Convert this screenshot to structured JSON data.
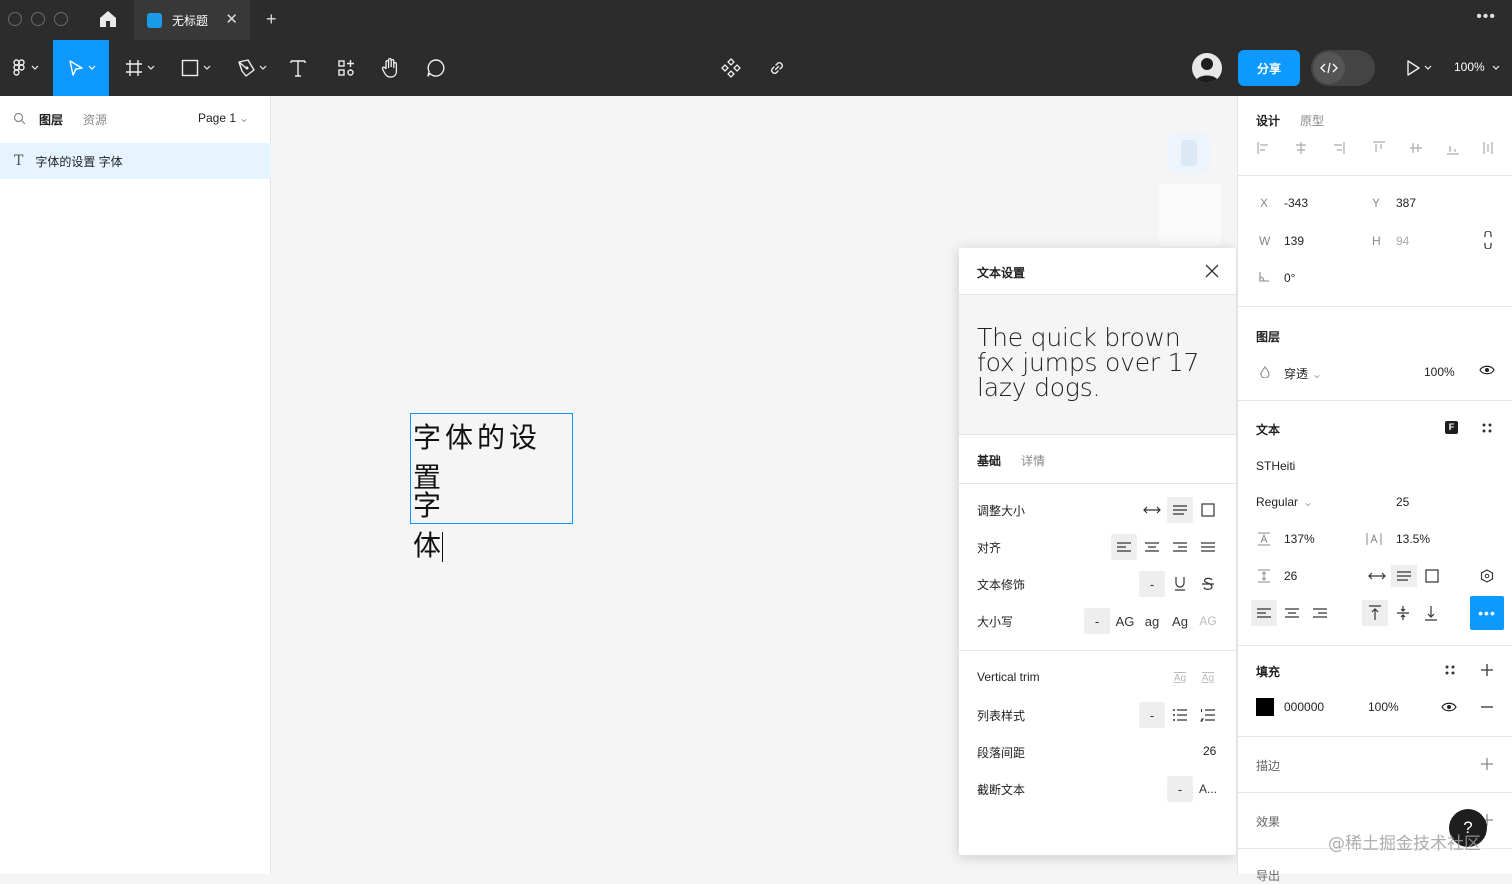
{
  "titlebar": {
    "tab_title": "无标题",
    "close_glyph": "✕",
    "plus_glyph": "+",
    "more_glyph": "•••"
  },
  "toolbar": {
    "share_label": "分享",
    "zoom": "100%"
  },
  "layers_panel": {
    "tab_layers": "图层",
    "tab_assets": "资源",
    "page_name": "Page 1",
    "layer_name": "字体的设置 字体"
  },
  "canvas": {
    "line1": "字体的设置",
    "line2": "字体"
  },
  "text_settings": {
    "title": "文本设置",
    "preview": "The quick brown fox jumps over 17 lazy dogs.",
    "tab_basic": "基础",
    "tab_details": "详情",
    "resize_label": "调整大小",
    "align_label": "对齐",
    "decoration_label": "文本修饰",
    "case_label": "大小写",
    "case_none": "-",
    "case_upper": "AG",
    "case_lower": "ag",
    "case_title": "Ag",
    "case_small": "AG",
    "deco_none": "-",
    "vertical_trim_label": "Vertical trim",
    "trim_opt1": "Ag",
    "trim_opt2": "Ag",
    "list_style_label": "列表样式",
    "list_none": "-",
    "paragraph_spacing_label": "段落间距",
    "paragraph_spacing_value": "26",
    "truncate_label": "截断文本",
    "truncate_none": "-",
    "truncate_ellipsis": "A..."
  },
  "design_panel": {
    "tab_design": "设计",
    "tab_prototype": "原型",
    "x_label": "X",
    "x_value": "-343",
    "y_label": "Y",
    "y_value": "387",
    "w_label": "W",
    "w_value": "139",
    "h_label": "H",
    "h_value": "94",
    "rotation_value": "0°",
    "layer_section": "图层",
    "blend_mode": "穿透",
    "layer_opacity": "100%",
    "text_section": "文本",
    "font_family": "STHeiti",
    "font_style": "Regular",
    "font_size": "25",
    "line_height": "137%",
    "letter_spacing": "13.5%",
    "paragraph_spacing": "26",
    "fill_section": "填充",
    "fill_hex": "000000",
    "fill_opacity": "100%",
    "stroke_section": "描边",
    "effects_section": "效果",
    "export_section": "导出"
  },
  "help": {
    "label": "?"
  },
  "watermark": "@稀土掘金技术社区",
  "colors": {
    "accent": "#0d99ff",
    "toolbar_bg": "#2c2c2c",
    "selection_bg": "#e5f4ff",
    "fill_swatch": "#000000"
  }
}
